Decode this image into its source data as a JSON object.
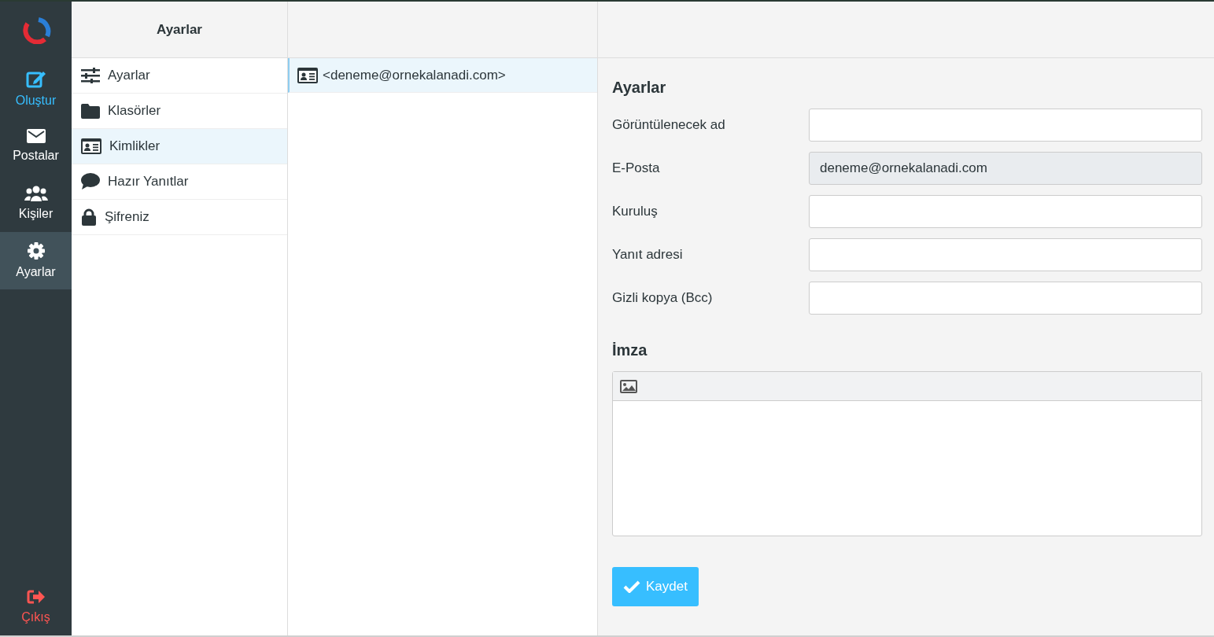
{
  "rail": {
    "items": [
      {
        "kind": "compose",
        "label": "Oluştur",
        "selected": false,
        "color": "#37beff"
      },
      {
        "kind": "mail",
        "label": "Postalar",
        "selected": false,
        "color": "#ffffff"
      },
      {
        "kind": "contacts",
        "label": "Kişiler",
        "selected": false,
        "color": "#ffffff"
      },
      {
        "kind": "settings",
        "label": "Ayarlar",
        "selected": true,
        "color": "#ffffff"
      }
    ],
    "logout": {
      "label": "Çıkış",
      "color": "#ff5552"
    }
  },
  "sections": {
    "title": "Ayarlar",
    "items": [
      {
        "kind": "sliders",
        "label": "Ayarlar",
        "selected": false
      },
      {
        "kind": "folder",
        "label": "Klasörler",
        "selected": false
      },
      {
        "kind": "idcard",
        "label": "Kimlikler",
        "selected": true
      },
      {
        "kind": "comment",
        "label": "Hazır Yanıtlar",
        "selected": false
      },
      {
        "kind": "lock",
        "label": "Şifreniz",
        "selected": false
      }
    ]
  },
  "identities": {
    "items": [
      {
        "label": "<deneme@ornekalanadi.com>",
        "selected": true
      }
    ]
  },
  "form": {
    "title": "Ayarlar",
    "fields": [
      {
        "label": "Görüntülenecek ad",
        "disabled": false
      },
      {
        "label": "E-Posta",
        "value": "deneme@ornekalanadi.com",
        "disabled": true
      },
      {
        "label": "Kuruluş",
        "disabled": false
      },
      {
        "label": "Yanıt adresi",
        "disabled": false
      },
      {
        "label": "Gizli kopya (Bcc)",
        "disabled": false
      }
    ],
    "signature_title": "İmza",
    "save_button": "Kaydet"
  }
}
